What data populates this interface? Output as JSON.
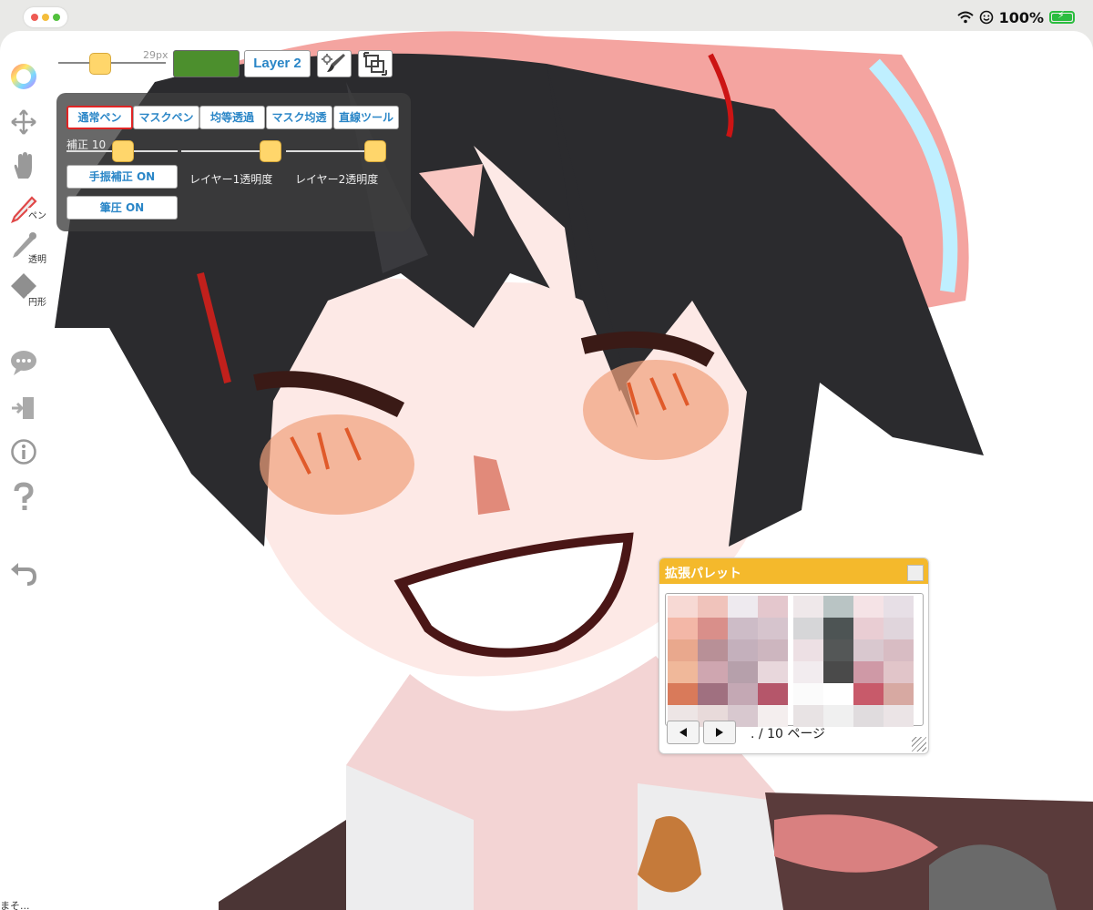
{
  "status_bar": {
    "battery_percent": "100%",
    "wifi_icon": "wifi-icon",
    "face_icon": "smiley-icon"
  },
  "top_toolbar": {
    "brush_size": "29px",
    "current_color": "#4c8f2d",
    "layer_label": "Layer 2",
    "icons": [
      "brush-settings-icon",
      "layer-transform-icon"
    ]
  },
  "left_toolbar": {
    "tools": [
      {
        "icon": "color-wheel-icon",
        "label": ""
      },
      {
        "icon": "move-arrows-icon",
        "label": ""
      },
      {
        "icon": "hand-icon",
        "label": ""
      },
      {
        "icon": "pen-icon",
        "label": "ペン"
      },
      {
        "icon": "eraser-icon",
        "label": "透明"
      },
      {
        "icon": "shape-icon",
        "label": "円形"
      },
      {
        "icon": "chat-icon",
        "label": ""
      },
      {
        "icon": "exit-icon",
        "label": ""
      },
      {
        "icon": "info-icon",
        "label": ""
      },
      {
        "icon": "help-icon",
        "label": ""
      },
      {
        "icon": "undo-icon",
        "label": ""
      }
    ]
  },
  "pen_panel": {
    "modes": [
      "通常ペン",
      "マスクペン",
      "均等透過",
      "マスク均透",
      "直線ツール"
    ],
    "active_mode": "通常ペン",
    "smoothing_label": "補正 10",
    "smoothing_value": 10,
    "stabilizer_button": "手振補正 ON",
    "pressure_button": "筆圧 ON",
    "layer1_opacity_label": "レイヤー1透明度",
    "layer1_opacity": 1.0,
    "layer2_opacity_label": "レイヤー2透明度",
    "layer2_opacity": 1.0
  },
  "palette": {
    "title": "拡張パレット",
    "page_indicator": ". / 10 ページ",
    "prev_icon": "left-triangle-icon",
    "next_icon": "right-triangle-icon",
    "colors_left": [
      "#f7d9d4",
      "#f0c3bb",
      "#eeeaef",
      "#e4c7cd",
      "#f3b7a7",
      "#d98f8a",
      "#cdbcc7",
      "#d6c4cd",
      "#e9a88d",
      "#b89097",
      "#c4b0bc",
      "#cdb6bf",
      "#f0b89a",
      "#cfa6b0",
      "#b6a0ab",
      "#e8d7dc",
      "#d97a5a",
      "#a07080",
      "#c4a8b4",
      "#b5566a",
      "#ede5e5",
      "#e8dada",
      "#d8c8cf",
      "#f4eeee"
    ],
    "colors_right": [
      "#efe8ea",
      "#b9c4c4",
      "#f5e3e6",
      "#e7dfe6",
      "#d6d6d8",
      "#4d5454",
      "#e9cdd3",
      "#e0d5dc",
      "#ede0e4",
      "#545757",
      "#d9c8cf",
      "#d8bcc3",
      "#f2ecef",
      "#4a4a4a",
      "#cf99a6",
      "#e1c5c9",
      "#fbfbfb",
      "#ffffff",
      "#c85a6a",
      "#d7a9a2",
      "#e8e3e4",
      "#f0f0f0",
      "#e0dcde",
      "#ebe4e6"
    ]
  },
  "bottom_left_text": "まそ..."
}
